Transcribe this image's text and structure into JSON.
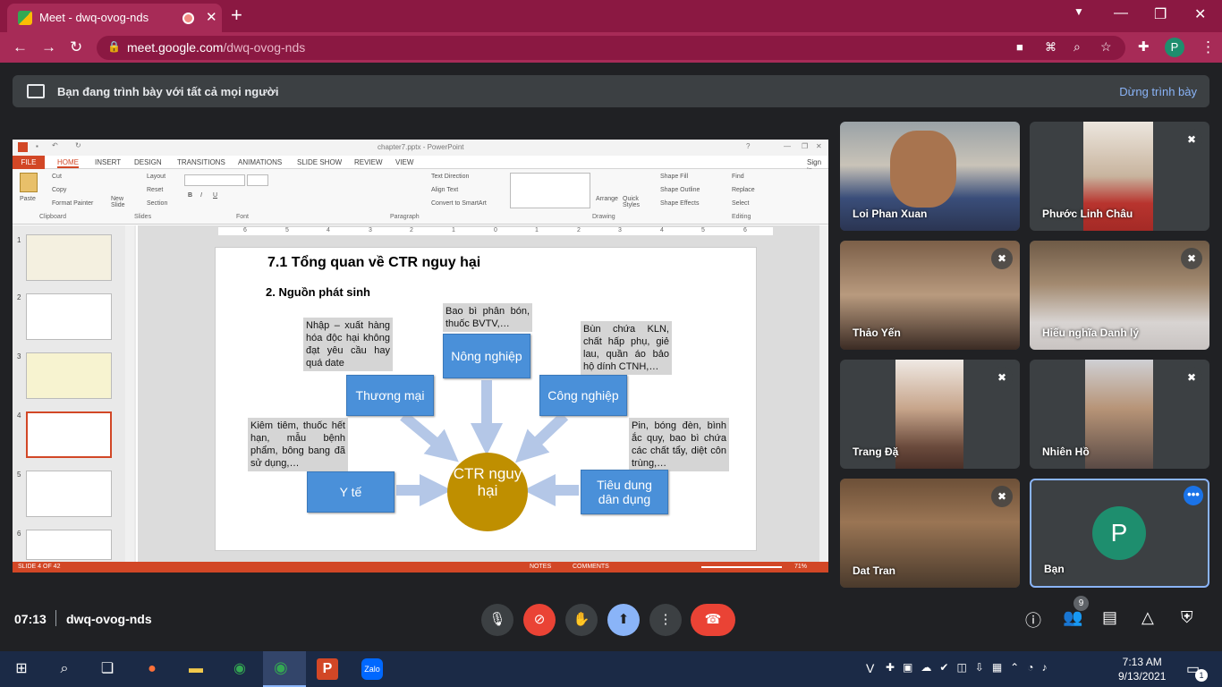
{
  "browser": {
    "tab_title": "Meet - dwq-ovog-nds",
    "tab_close": "✕",
    "new_tab": "+",
    "url_host": "meet.google.com",
    "url_path": "/dwq-ovog-nds",
    "profile_initial": "P",
    "window_controls": [
      "—",
      "❐",
      "✕"
    ]
  },
  "banner": {
    "message": "Bạn đang trình bày với tất cả mọi người",
    "stop_label": "Dừng trình bày"
  },
  "powerpoint": {
    "window_title": "chapter7.pptx - PowerPoint",
    "sign_in": "Sign in",
    "menu_tabs": [
      "FILE",
      "HOME",
      "INSERT",
      "DESIGN",
      "TRANSITIONS",
      "ANIMATIONS",
      "SLIDE SHOW",
      "REVIEW",
      "VIEW"
    ],
    "ribbon": {
      "paste": "Paste",
      "cut": "Cut",
      "copy": "Copy",
      "format_painter": "Format Painter",
      "new_slide": "New Slide",
      "layout": "Layout",
      "reset": "Reset",
      "section": "Section",
      "text_direction": "Text Direction",
      "align_text": "Align Text",
      "convert_smartart": "Convert to SmartArt",
      "arrange": "Arrange",
      "quick_styles": "Quick Styles",
      "shape_fill": "Shape Fill",
      "shape_outline": "Shape Outline",
      "shape_effects": "Shape Effects",
      "find": "Find",
      "replace": "Replace",
      "select": "Select",
      "groups": [
        "Clipboard",
        "Slides",
        "Font",
        "Paragraph",
        "Drawing",
        "Editing"
      ]
    },
    "thumb_numbers": [
      "1",
      "2",
      "3",
      "4",
      "5",
      "6"
    ],
    "ruler_ticks": [
      "6",
      "5",
      "4",
      "3",
      "2",
      "1",
      "0",
      "1",
      "2",
      "3",
      "4",
      "5",
      "6"
    ],
    "status": {
      "slide_of": "SLIDE 4 OF 42",
      "notes": "NOTES",
      "comments": "COMMENTS",
      "zoom": "71%"
    },
    "slide": {
      "title": "7.1 Tổng quan về CTR nguy hại",
      "subtitle": "2. Nguồn phát sinh",
      "center": "CTR nguy hại",
      "boxes": {
        "thuong_mai": "Thương mại",
        "nong_nghiep": "Nông nghiệp",
        "cong_nghiep": "Công nghiệp",
        "y_te": "Y tế",
        "tieu_dung": "Tiêu dung dân dụng"
      },
      "notes": {
        "nong_nghiep": "Bao bì phân bón, thuốc BVTV,…",
        "thuong_mai": "Nhập – xuất hàng hóa độc hại không đạt yêu cầu hay quá date",
        "cong_nghiep": "Bùn chứa KLN, chất hấp phụ, giẻ lau, quần áo bảo hộ dính CTNH,…",
        "y_te": "Kiêm tiêm, thuốc hết hạn, mẫu bệnh phẩm, bông bang đã sử dụng,…",
        "tieu_dung": "Pin, bóng đèn, bình ắc quy, bao bì chứa các chất tẩy, diệt côn trùng,…"
      }
    }
  },
  "participants": [
    {
      "name": "Loi Phan Xuan",
      "muted": false
    },
    {
      "name": "Phước Linh Châu",
      "muted": true
    },
    {
      "name": "Thảo Yến",
      "muted": true
    },
    {
      "name": "Hiếu nghĩa Danh lý",
      "muted": true
    },
    {
      "name": "Trang Đặ",
      "muted": true
    },
    {
      "name": "Nhiên Hồ",
      "muted": true
    },
    {
      "name": "Dat Tran",
      "muted": true
    },
    {
      "name": "Bạn",
      "initial": "P",
      "muted": false
    }
  ],
  "meeting": {
    "time": "07:13",
    "code": "dwq-ovog-nds",
    "people_count": "9"
  },
  "taskbar": {
    "time": "7:13 AM",
    "date": "9/13/2021",
    "lang": "V",
    "notif_count": "1"
  },
  "colors": {
    "tab_bar": "#8b1842",
    "addr_bar": "#a72b57",
    "meet_bg": "#202124",
    "end_call": "#ea4335",
    "ppt_accent": "#d24726",
    "box_blue": "#4a90d9",
    "ctr_gold": "#bf8f00"
  }
}
